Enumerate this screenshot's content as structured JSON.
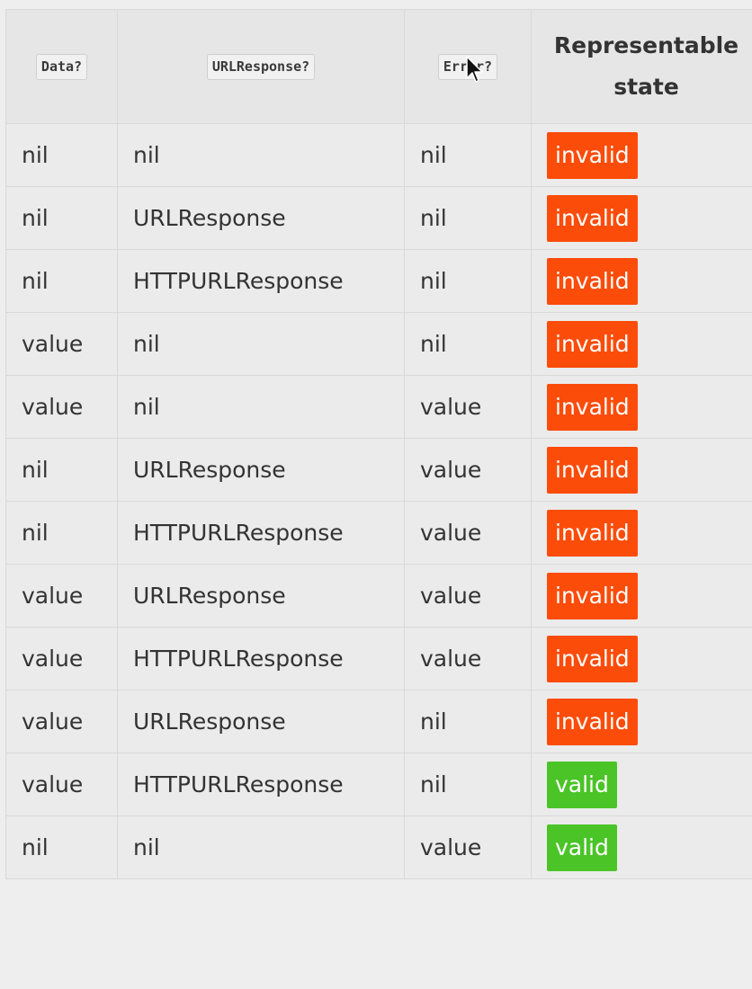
{
  "table": {
    "headers": [
      "Data?",
      "URLResponse?",
      "Error?",
      "Representable state"
    ],
    "rows": [
      {
        "data": "nil",
        "response": "nil",
        "error": "nil",
        "state": "invalid"
      },
      {
        "data": "nil",
        "response": "URLResponse",
        "error": "nil",
        "state": "invalid"
      },
      {
        "data": "nil",
        "response": "HTTPURLResponse",
        "error": "nil",
        "state": "invalid"
      },
      {
        "data": "value",
        "response": "nil",
        "error": "nil",
        "state": "invalid"
      },
      {
        "data": "value",
        "response": "nil",
        "error": "value",
        "state": "invalid"
      },
      {
        "data": "nil",
        "response": "URLResponse",
        "error": "value",
        "state": "invalid"
      },
      {
        "data": "nil",
        "response": "HTTPURLResponse",
        "error": "value",
        "state": "invalid"
      },
      {
        "data": "value",
        "response": "URLResponse",
        "error": "value",
        "state": "invalid"
      },
      {
        "data": "value",
        "response": "HTTPURLResponse",
        "error": "value",
        "state": "invalid"
      },
      {
        "data": "value",
        "response": "URLResponse",
        "error": "nil",
        "state": "invalid"
      },
      {
        "data": "value",
        "response": "HTTPURLResponse",
        "error": "nil",
        "state": "valid"
      },
      {
        "data": "nil",
        "response": "nil",
        "error": "value",
        "state": "valid"
      }
    ]
  },
  "colors": {
    "invalid": "#fc4c0a",
    "valid": "#4ac427"
  },
  "icons": {
    "cursor": "mouse-pointer-icon"
  }
}
